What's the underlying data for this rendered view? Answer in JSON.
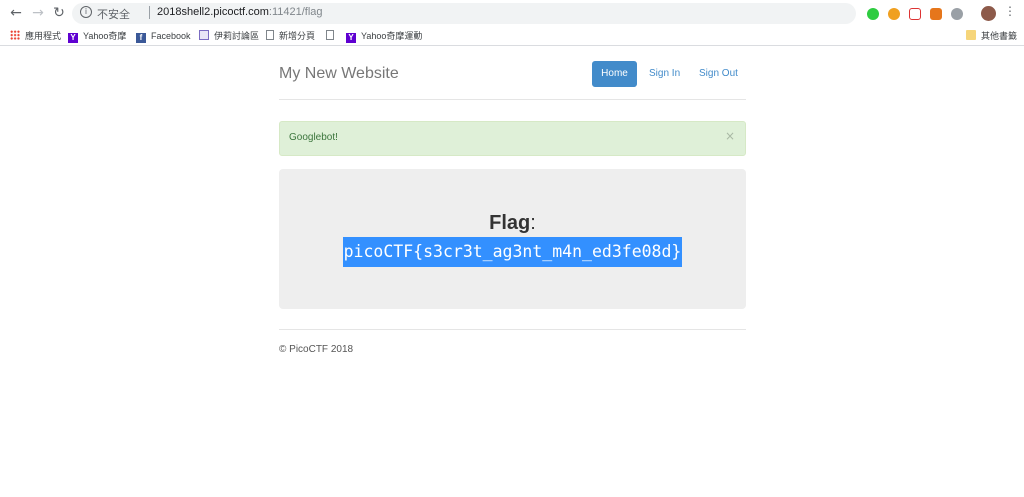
{
  "browser": {
    "url_security": "不安全",
    "url_host": "2018shell2.picoctf.com",
    "url_path": ":11421/flag",
    "bookmarks": [
      {
        "label": "應用程式",
        "icon": "apps-icon"
      },
      {
        "label": "Yahoo奇摩",
        "icon": "yahoo-icon"
      },
      {
        "label": "Facebook",
        "icon": "facebook-icon"
      },
      {
        "label": "伊莉討論區",
        "icon": "forum-icon"
      },
      {
        "label": "新增分頁",
        "icon": "page-icon"
      },
      {
        "label": "",
        "icon": "page-icon"
      },
      {
        "label": "Yahoo奇摩運動",
        "icon": "yahoo-icon"
      }
    ],
    "other_bookmarks": "其他書籤"
  },
  "site": {
    "title": "My New Website",
    "nav": {
      "home": "Home",
      "sign_in": "Sign In",
      "sign_out": "Sign Out"
    }
  },
  "alert": {
    "message": "Googlebot!",
    "close": "×"
  },
  "flag": {
    "label": "Flag",
    "colon": ":",
    "value": "picoCTF{s3cr3t_ag3nt_m4n_ed3fe08d}"
  },
  "footer": {
    "text": "© PicoCTF 2018"
  },
  "colors": {
    "primary": "#428bca",
    "alert_bg": "#dff0d8",
    "alert_text": "#3c763d",
    "selection": "#3390ff"
  }
}
